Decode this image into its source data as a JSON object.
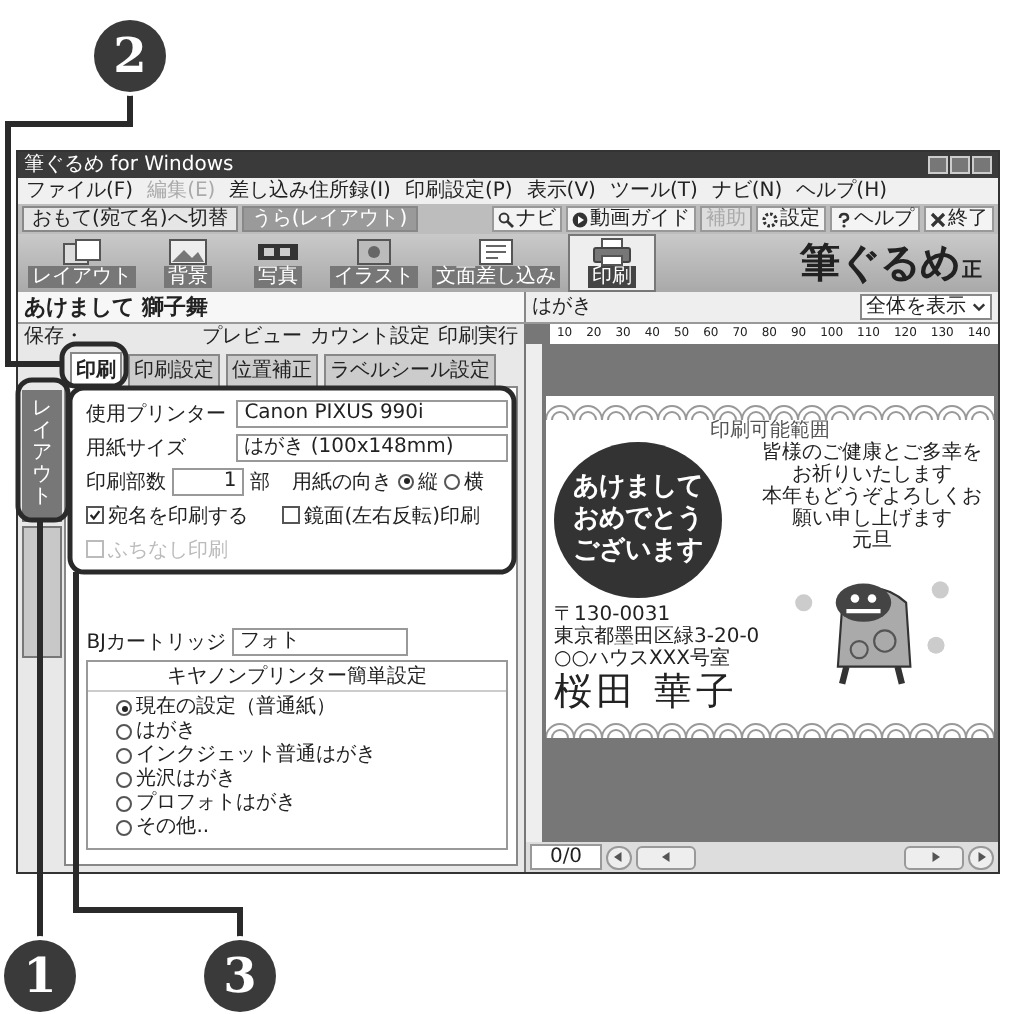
{
  "window": {
    "title": "筆ぐるめ for Windows"
  },
  "menu": [
    {
      "label": "ファイル(F)",
      "disabled": false
    },
    {
      "label": "編集(E)",
      "disabled": true
    },
    {
      "label": "差し込み住所録(I)",
      "disabled": false
    },
    {
      "label": "印刷設定(P)",
      "disabled": false
    },
    {
      "label": "表示(V)",
      "disabled": false
    },
    {
      "label": "ツール(T)",
      "disabled": false
    },
    {
      "label": "ナビ(N)",
      "disabled": false
    },
    {
      "label": "ヘルプ(H)",
      "disabled": false
    }
  ],
  "mode_tabs": [
    {
      "label": "おもて(宛て名)へ切替",
      "selected": false
    },
    {
      "label": "うら(レイアウト)",
      "selected": true
    }
  ],
  "toolbar_buttons": [
    {
      "label": "ナビ",
      "disabled": false
    },
    {
      "label": "動画ガイド",
      "disabled": false
    },
    {
      "label": "補助",
      "disabled": true
    },
    {
      "label": "設定",
      "disabled": false
    },
    {
      "label": "ヘルプ",
      "disabled": false
    },
    {
      "label": "終了",
      "disabled": false
    }
  ],
  "tools": [
    {
      "label": "レイアウト",
      "selected": false
    },
    {
      "label": "背景",
      "selected": false
    },
    {
      "label": "写真",
      "selected": false
    },
    {
      "label": "イラスト",
      "selected": false
    },
    {
      "label": "文面差し込み",
      "selected": false
    },
    {
      "label": "印刷",
      "selected": true
    }
  ],
  "logo": {
    "text": "筆ぐるめ",
    "badge": "正"
  },
  "document_title": "あけまして 獅子舞",
  "left_toolbar": {
    "save": "保存・",
    "actions": [
      "プレビュー",
      "カウント設定",
      "印刷実行"
    ]
  },
  "print_tabs": [
    {
      "label": "印刷",
      "selected": true
    },
    {
      "label": "印刷設定",
      "selected": false
    },
    {
      "label": "位置補正",
      "selected": false
    },
    {
      "label": "ラベルシール設定",
      "selected": false
    }
  ],
  "side_tabs": [
    {
      "label": "レイアウト",
      "selected": true
    },
    {
      "selected": false
    }
  ],
  "print_form": {
    "printer_label": "使用プリンター",
    "printer_value": "Canon PIXUS 990i",
    "paper_label": "用紙サイズ",
    "paper_value": "はがき (100x148mm)",
    "copies_label": "印刷部数",
    "copies_value": "1",
    "copies_unit": "部",
    "orientation_label": "用紙の向き",
    "orientation_options": [
      {
        "label": "縦",
        "selected": true
      },
      {
        "label": "横",
        "selected": false
      }
    ],
    "checkboxes": [
      {
        "label": "宛名を印刷する",
        "checked": true,
        "disabled": false
      },
      {
        "label": "鏡面(左右反転)印刷",
        "checked": false,
        "disabled": false
      },
      {
        "label": "ふちなし印刷",
        "checked": false,
        "disabled": true
      }
    ]
  },
  "cartridge": {
    "label": "BJカートリッジ",
    "value": "フォト"
  },
  "easy_settings": {
    "title": "キヤノンプリンター簡単設定",
    "options": [
      {
        "label": "現在の設定（普通紙）",
        "selected": true
      },
      {
        "label": "はがき",
        "selected": false
      },
      {
        "label": "インクジェット普通はがき",
        "selected": false
      },
      {
        "label": "光沢はがき",
        "selected": false
      },
      {
        "label": "プロフォトはがき",
        "selected": false
      },
      {
        "label": "その他..",
        "selected": false
      }
    ]
  },
  "preview": {
    "title": "はがき",
    "zoom": "全体を表示",
    "ruler": [
      "10",
      "20",
      "30",
      "40",
      "50",
      "60",
      "70",
      "80",
      "90",
      "100",
      "110",
      "120",
      "130",
      "140"
    ],
    "postcard": {
      "area_label": "印刷可能範囲",
      "greeting": [
        "あけまして",
        "おめでとう",
        "ございます"
      ],
      "message": [
        "皆様のご健康とご多幸をお祈りいたします",
        "本年もどうぞよろしくお願い申し上げます",
        "元旦"
      ],
      "address": [
        "〒130-0031",
        "東京都墨田区緑3-20-0",
        "○○ハウスXXX号室"
      ],
      "name": "桜田 華子"
    }
  },
  "pager": {
    "page": "0/0"
  },
  "callouts": [
    {
      "number": "2"
    },
    {
      "number": "1"
    },
    {
      "number": "3"
    }
  ]
}
